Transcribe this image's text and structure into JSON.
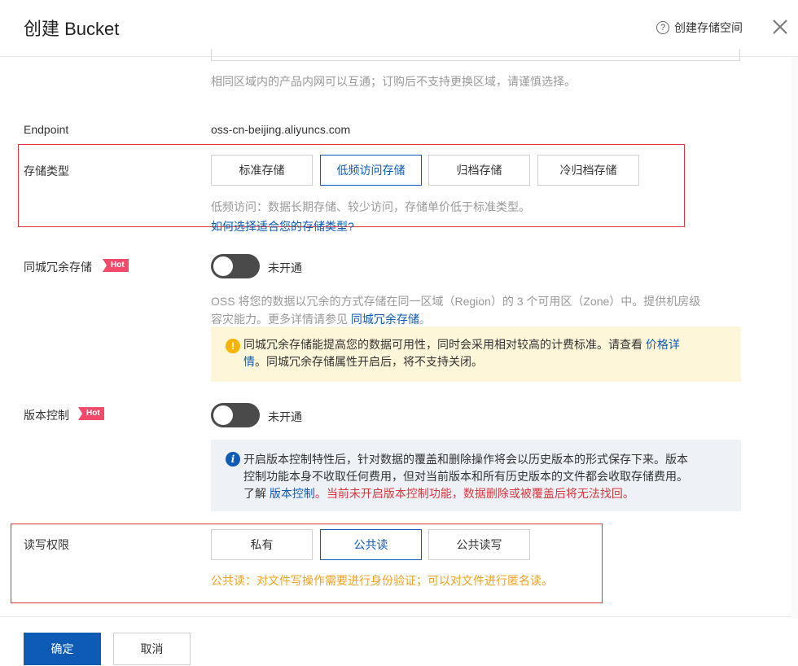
{
  "header": {
    "title": "创建 Bucket",
    "help_link": "创建存储空间",
    "help_icon": "?"
  },
  "region": {
    "hint": "相同区域内的产品内网可以互通；订购后不支持更换区域，请谨慎选择。"
  },
  "endpoint": {
    "label": "Endpoint",
    "value": "oss-cn-beijing.aliyuncs.com"
  },
  "storage_class": {
    "label": "存储类型",
    "options": [
      "标准存储",
      "低频访问存储",
      "归档存储",
      "冷归档存储"
    ],
    "selected": "低频访问存储",
    "hint": "低频访问：数据长期存储、较少访问，存储单价低于标准类型。",
    "help_link": "如何选择适合您的存储类型?"
  },
  "zone_redundant": {
    "label": "同城冗余存储",
    "badge": "Hot",
    "toggle_state": "未开通",
    "desc_line1": "OSS 将您的数据以冗余的方式存储在同一区域（Region）的 3 个可用区（Zone）中。提供机房级",
    "desc_line2": "容灾能力。更多详情请参见 ",
    "desc_link": "同城冗余存储",
    "desc_end": "。",
    "warning_line1": "同城冗余存储能提高您的数据可用性，同时会采用相对较高的计费标准。请查看 ",
    "warning_link1": "价格详",
    "warning_link2": "情",
    "warning_line2": "。同城冗余存储属性开启后，将不支持关闭。",
    "warning_icon": "!"
  },
  "versioning": {
    "label": "版本控制",
    "badge": "Hot",
    "toggle_state": "未开通",
    "info_line1": "开启版本控制特性后，针对数据的覆盖和删除操作将会以历史版本的形式保存下来。版本",
    "info_line2": "控制功能本身不收取任何费用，但对当前版本和所有历史版本的文件都会收取存储费用。",
    "info_line3_prefix": "了解 ",
    "info_link": "版本控制",
    "info_red": "。当前未开启版本控制功能，数据删除或被覆盖后将无法找回。",
    "info_icon": "i"
  },
  "acl": {
    "label": "读写权限",
    "options": [
      "私有",
      "公共读",
      "公共读写"
    ],
    "selected": "公共读",
    "hint": "公共读：对文件写操作需要进行身份验证；可以对文件进行匿名读。"
  },
  "footer": {
    "confirm": "确定",
    "cancel": "取消"
  },
  "colors": {
    "primary": "#0d5bb5",
    "highlight_box": "#d9363e",
    "hot_badge": "#f04b6b",
    "warning_bg": "#fdf6d8",
    "info_bg": "#eef2f7",
    "acl_hint": "#f0a020"
  }
}
